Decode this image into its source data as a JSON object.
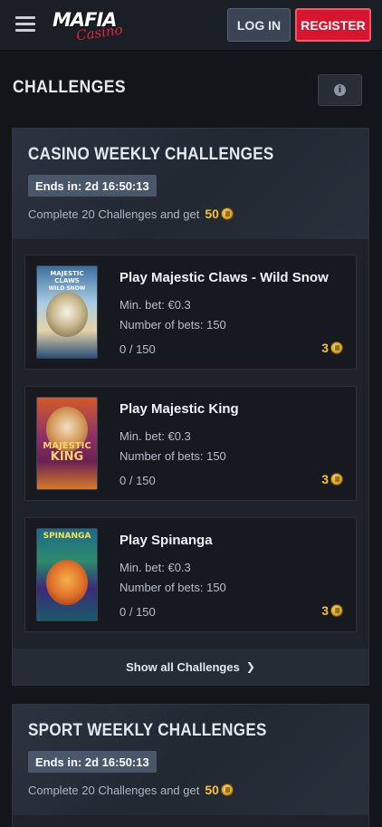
{
  "header": {
    "logo_text": "MAFIA",
    "logo_sub": "Casino",
    "login_label": "LOG IN",
    "register_label": "REGISTER",
    "colors": {
      "register": "#d8152e",
      "login": "#3a4455"
    }
  },
  "page": {
    "title": "CHALLENGES"
  },
  "casino": {
    "title": "CASINO WEEKLY CHALLENGES",
    "ends_in": "Ends in: 2d 16:50:13",
    "complete_text": "Complete 20 Challenges and get",
    "reward": "50",
    "show_all": "Show all Challenges",
    "cards": [
      {
        "title": "Play Majestic Claws - Wild Snow",
        "min_bet": "Min. bet: €0.3",
        "num_bets": "Number of bets: 150",
        "progress": "0 / 150",
        "reward": "3",
        "thumb_title": "MAJESTIC CLAWS",
        "thumb_sub": "WILD SNOW"
      },
      {
        "title": "Play Majestic King",
        "min_bet": "Min. bet: €0.3",
        "num_bets": "Number of bets: 150",
        "progress": "0 / 150",
        "reward": "3",
        "thumb_title": "MAJESTIC",
        "thumb_sub": "KING"
      },
      {
        "title": "Play Spinanga",
        "min_bet": "Min. bet: €0.3",
        "num_bets": "Number of bets: 150",
        "progress": "0 / 150",
        "reward": "3",
        "thumb_title": "SPINANGA",
        "thumb_sub": ""
      }
    ]
  },
  "sport": {
    "title": "SPORT WEEKLY CHALLENGES",
    "ends_in": "Ends in: 2d 16:50:13",
    "complete_text": "Complete 20 Challenges and get",
    "reward": "50"
  }
}
